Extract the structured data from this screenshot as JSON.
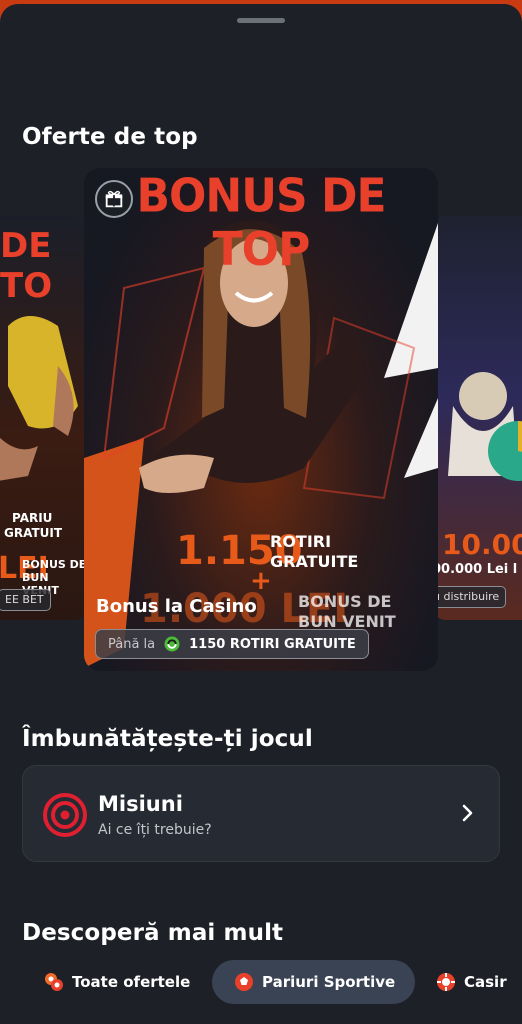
{
  "sections": {
    "top_offers": "Oferte de top",
    "improve": "Îmbunătățește-ți jocul",
    "discover": "Descoperă mai mult"
  },
  "carousel": {
    "main": {
      "headline": "BONUS DE TOP",
      "spins_amount": "1.150",
      "spins_label_1": "ROTIRI",
      "spins_label_2": "GRATUITE",
      "plus": "+",
      "lei_amount": "1.000 LEI",
      "bonus_label_1": "BONUS DE",
      "bonus_label_2": "BUN VENIT",
      "title": "Bonus la Casino",
      "pill_label": "Până la",
      "pill_value": "1150 ROTIRI GRATUITE"
    },
    "left": {
      "headline": "DE TO",
      "line1": "PARIU",
      "line2": "GRATUIT",
      "lei": "LEI",
      "bonus_1": "BONUS DE",
      "bonus_2": "BUN VENIT",
      "pill": "EE BET"
    },
    "right": {
      "amount": "10.000",
      "sub": "00.000 Lei l",
      "pill": "u distribuire"
    }
  },
  "missions": {
    "title": "Misiuni",
    "subtitle": "Ai ce îți trebuie?"
  },
  "tabs": [
    {
      "label": "Toate ofertele"
    },
    {
      "label": "Pariuri Sportive"
    },
    {
      "label": "Casir"
    }
  ],
  "colors": {
    "accent": "#e8402a",
    "background": "#1d2026",
    "active_tab": "#3a4354"
  }
}
